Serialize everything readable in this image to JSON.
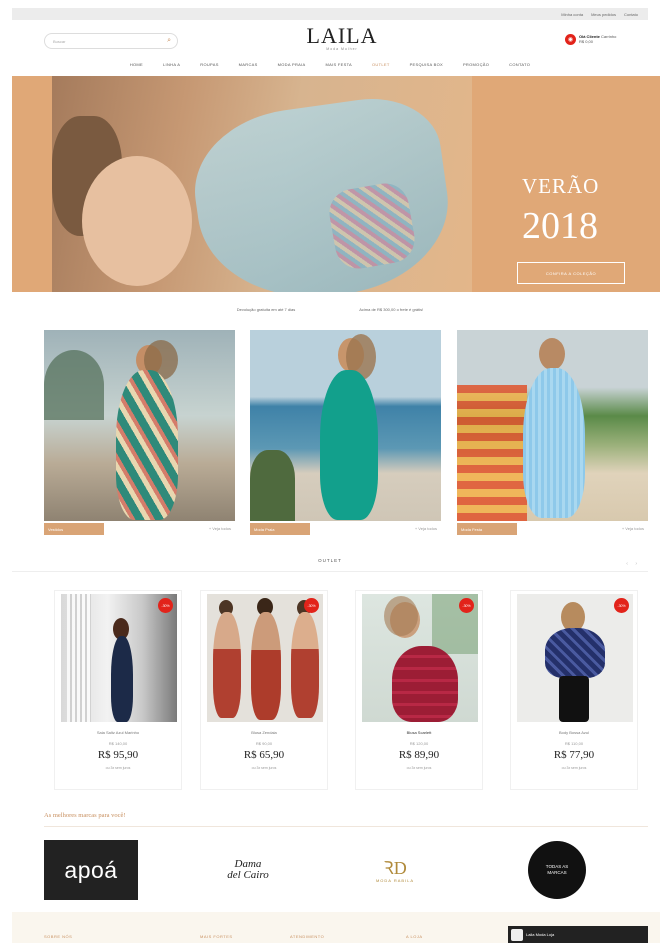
{
  "topbar": {
    "links": [
      "Minha conta",
      "Meus pedidos",
      "Contato"
    ]
  },
  "header": {
    "search_placeholder": "Buscar",
    "logo_name": "LAILA",
    "logo_tagline": "Moda Mulher",
    "account_line1": "Olá Cliente",
    "account_line2": "Carrinho",
    "account_line3": "R$ 0,00"
  },
  "nav": {
    "items": [
      "HOME",
      "LINHA A",
      "ROUPAS",
      "MARCAS",
      "MODA PRAIA",
      "MAIS FESTA",
      "OUTLET",
      "PESQUISA BOX",
      "PROMOÇÃO",
      "CONTATO"
    ],
    "active_index": 6
  },
  "hero": {
    "title_line1": "VERÃO",
    "title_line2": "2018",
    "cta": "CONFIRA A COLEÇÃO"
  },
  "shipping": {
    "left": "Devolução gratuita em até 7 dias",
    "right": "Acima de R$ 300,00 o frete é grátis!"
  },
  "categories": [
    {
      "label": "Vestidos",
      "more": "+ Veja todos"
    },
    {
      "label": "Moda Praia",
      "more": "+ Veja todos"
    },
    {
      "label": "Moda Festa",
      "more": "+ Veja todos"
    }
  ],
  "outlet": {
    "title": "OUTLET",
    "arrows": "‹ ›"
  },
  "products": [
    {
      "name": "Saia Saltz Azul Marinho",
      "old_price": "R$ 140,00",
      "price": "R$ 95,90",
      "installments": "ou 3x sem juros",
      "badge": "-30%"
    },
    {
      "name": "Blusa Zendaia",
      "old_price": "R$ 90,00",
      "price": "R$ 65,90",
      "installments": "ou 3x sem juros",
      "badge": "-30%"
    },
    {
      "name": "Blusa Scarlett",
      "old_price": "R$ 120,00",
      "price": "R$ 89,90",
      "installments": "ou 3x sem juros",
      "badge": "-30%"
    },
    {
      "name": "Body Bossa Azul",
      "old_price": "R$ 110,00",
      "price": "R$ 77,90",
      "installments": "ou 3x sem juros",
      "badge": "-30%"
    }
  ],
  "brands": {
    "title": "As melhores marcas para você!",
    "apoa": "apoá",
    "dama_line1": "Dama",
    "dama_line2": "del Cairo",
    "moda_mono": "ꝚD",
    "moda_text": "MODA RABILA",
    "todas_line1": "TODAS AS",
    "todas_line2": "MARCAS"
  },
  "footer": {
    "cols": [
      "SOBRE NÓS",
      "MAIS FORTES",
      "ATENDIMENTO",
      "A LOJA"
    ],
    "fb_label": "Laila Moda Loja"
  },
  "colors": {
    "accent": "#c89060",
    "sale_badge": "#e2231a",
    "hero_bg": "#e0a877"
  }
}
